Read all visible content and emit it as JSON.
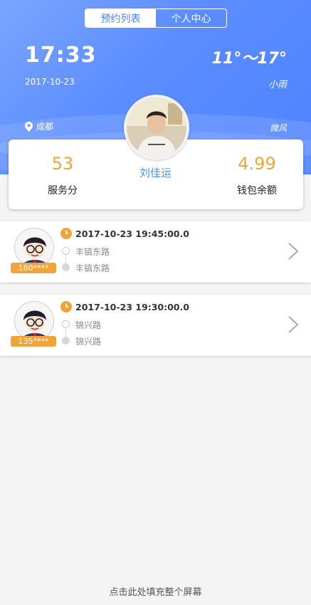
{
  "tabs": [
    {
      "label": "预约列表",
      "active": true
    },
    {
      "label": "个人中心",
      "active": false
    }
  ],
  "header": {
    "time": "17:33",
    "date": "2017-10-23",
    "temperature": "11°～17°",
    "weather": "小雨",
    "city": "成都",
    "wind": "微风"
  },
  "profile": {
    "name": "刘佳运",
    "score": "53",
    "score_label": "服务分",
    "balance": "4.99",
    "balance_label": "钱包余额"
  },
  "orders": [
    {
      "phone": "180****",
      "time": "2017-10-23 19:45:00.0",
      "from": "丰镐东路",
      "to": "丰镐东路"
    },
    {
      "phone": "135****",
      "time": "2017-10-23 19:30:00.0",
      "from": "锦兴路",
      "to": "锦兴路"
    }
  ],
  "footer": {
    "text": "点击此处填充整个屏幕"
  },
  "colors": {
    "primary": "#4f82ff",
    "accent": "#f0a43a",
    "name": "#4a90e2"
  },
  "icons": [
    "location-pin-icon",
    "clock-icon",
    "chevron-right-icon"
  ]
}
